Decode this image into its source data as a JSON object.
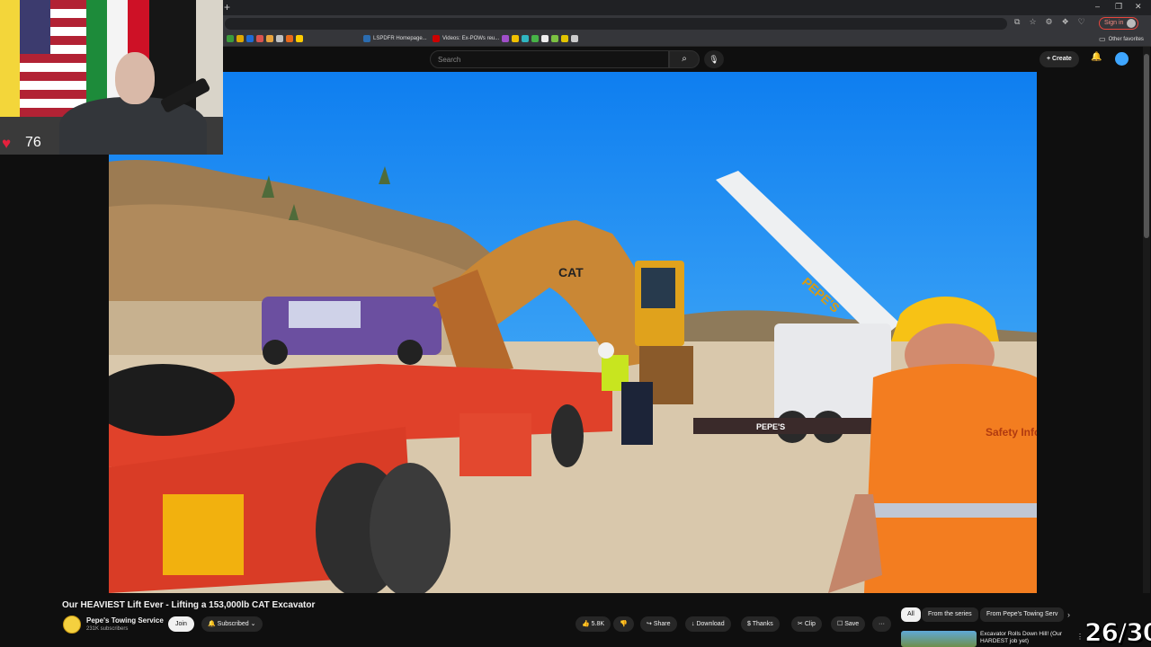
{
  "browser": {
    "new_tab_glyph": "+",
    "window_controls": [
      "–",
      "❐",
      "✕"
    ],
    "sign_in_label": "Sign in",
    "other_favorites_label": "Other favorites",
    "bookmarks": [
      {
        "label": "LSPDFR Homepage...",
        "color": "#2b6cb0"
      },
      {
        "label": "Videos: Ex-POWs reu...",
        "color": "#cc0000"
      }
    ]
  },
  "youtube": {
    "search_placeholder": "Search",
    "create_label": "+ Create",
    "video": {
      "title": "Our HEAVIEST Lift Ever - Lifting a 153,000lb CAT Excavator",
      "channel_name": "Pepe's Towing Service",
      "subscribers": "231K subscribers",
      "join_label": "Join",
      "subscribed_label": "Subscribed",
      "likes": "5.8K",
      "share_label": "Share",
      "download_label": "Download",
      "thanks_label": "Thanks",
      "clip_label": "Clip",
      "save_label": "Save",
      "more_label": "···"
    },
    "recommendation_chips": [
      "All",
      "From the series",
      "From Pepe's Towing Serv"
    ],
    "recommendation": {
      "title": "Excavator Rolls Down Hill! (Our HARDEST job yet)"
    }
  },
  "overlay": {
    "heart_rate": "76",
    "counter": "26/30"
  },
  "scene_text": {
    "cat_logo": "CAT",
    "crane_brand": "PEPE'S",
    "trailer_brand": "PEPE'S",
    "vest_text": "Safety Infor t"
  },
  "colors": {
    "youtube_bg": "#0f0f0f",
    "sky": "#1f8bf0",
    "trailer_red": "#e0412a",
    "cat_yellow": "#f2b10e",
    "vest_orange": "#f37d20",
    "hard_hat": "#f7c215",
    "heart": "#e5213d"
  }
}
